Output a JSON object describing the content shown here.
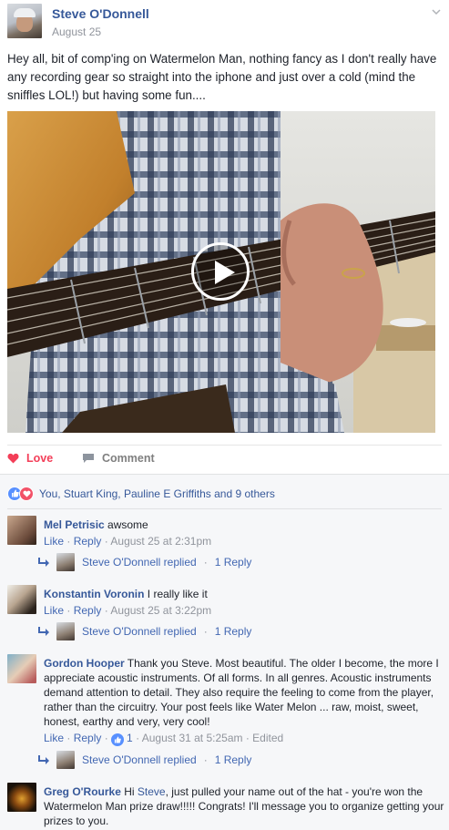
{
  "post": {
    "author": "Steve O'Donnell",
    "date": "August 25",
    "text": "Hey all, bit of comp'ing on Watermelon Man, nothing fancy as I don't really have any recording gear so straight into the iphone and just over a cold (mind the sniffles LOL!) but having some fun...."
  },
  "actions": {
    "love_label": "Love",
    "comment_label": "Comment"
  },
  "reactions": {
    "summary": "You, Stuart King, Pauline E Griffiths and 9 others"
  },
  "comments": [
    {
      "name": "Mel Petrisic",
      "text": "awsome",
      "like": "Like",
      "reply": "Reply",
      "time": "August 25 at 2:31pm",
      "replied_by": "Steve O'Donnell replied",
      "reply_count": "1 Reply"
    },
    {
      "name": "Konstantin Voronin",
      "text": "I really like it",
      "like": "Like",
      "reply": "Reply",
      "time": "August 25 at 3:22pm",
      "replied_by": "Steve O'Donnell replied",
      "reply_count": "1 Reply"
    },
    {
      "name": "Gordon Hooper",
      "text": "Thank you Steve. Most beautiful. The older I become, the more I appreciate acoustic instruments. Of all forms. In all genres. Acoustic instruments demand attention to detail. They also require the feeling to come from the player, rather than the circuitry. Your post feels like Water Melon ... raw, moist, sweet, honest, earthy and very, very cool!",
      "like": "Like",
      "reply": "Reply",
      "like_count": "1",
      "time": "August 31 at 5:25am",
      "edited": "Edited",
      "replied_by": "Steve O'Donnell replied",
      "reply_count": "1 Reply"
    },
    {
      "name": "Greg O'Rourke",
      "text_pre": "Hi",
      "mention": "Steve",
      "text_post": ", just pulled your name out of the hat - you're won the Watermelon Man prize draw!!!!! Congrats! I'll message you to organize getting your prizes to you."
    }
  ]
}
